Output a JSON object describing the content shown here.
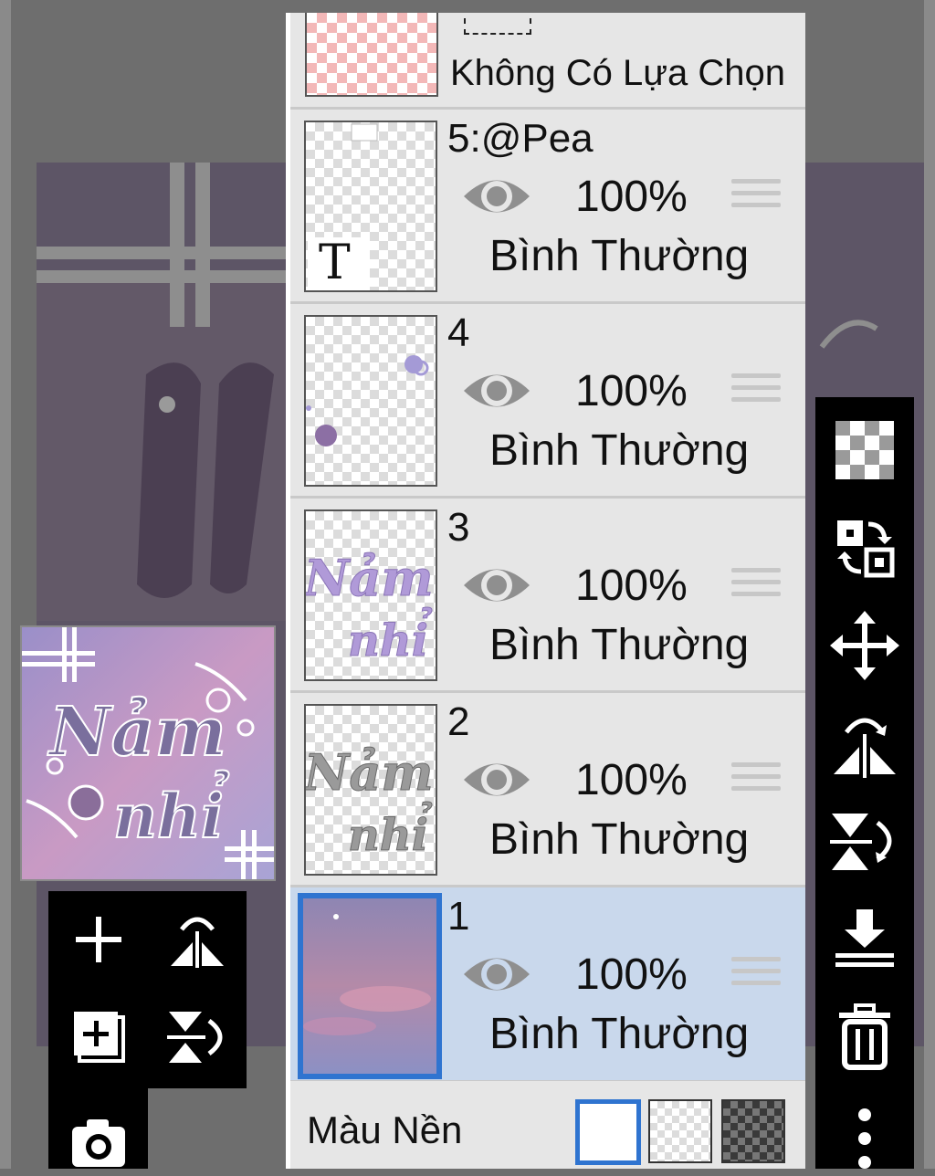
{
  "layers_panel": {
    "selection_row": {
      "label": "Không Có Lựa Chọn"
    },
    "layers": [
      {
        "name": "5:@Pea",
        "opacity": "100%",
        "blend_mode": "Bình Thường",
        "visible": true,
        "selected": false,
        "type": "text"
      },
      {
        "name": "4",
        "opacity": "100%",
        "blend_mode": "Bình Thường",
        "visible": true,
        "selected": false
      },
      {
        "name": "3",
        "opacity": "100%",
        "blend_mode": "Bình Thường",
        "visible": true,
        "selected": false
      },
      {
        "name": "2",
        "opacity": "100%",
        "blend_mode": "Bình Thường",
        "visible": true,
        "selected": false
      },
      {
        "name": "1",
        "opacity": "100%",
        "blend_mode": "Bình Thường",
        "visible": true,
        "selected": true
      }
    ],
    "background_color": {
      "label": "Màu Nền",
      "options": [
        "white",
        "transparent",
        "dark-checker"
      ],
      "selected": "white"
    },
    "text_layer_glyph": "T"
  },
  "right_toolbar": {
    "icons": [
      "transparency-checker-icon",
      "swap-layers-icon",
      "move-icon",
      "flip-horizontal-icon",
      "flip-vertical-icon",
      "merge-down-icon",
      "trash-icon",
      "more-vertical-icon"
    ]
  },
  "left_toolbar": {
    "icons": [
      "add-layer-icon",
      "flip-horizontal-icon",
      "add-layer-copy-icon",
      "flip-vertical-icon",
      "camera-icon"
    ]
  },
  "colors": {
    "accent": "#2f74d0",
    "panel_row": "#e6e6e6",
    "selected_row": "#c9d8ec",
    "background_dim": "#6e6e6e",
    "toolbar": "#000000"
  }
}
